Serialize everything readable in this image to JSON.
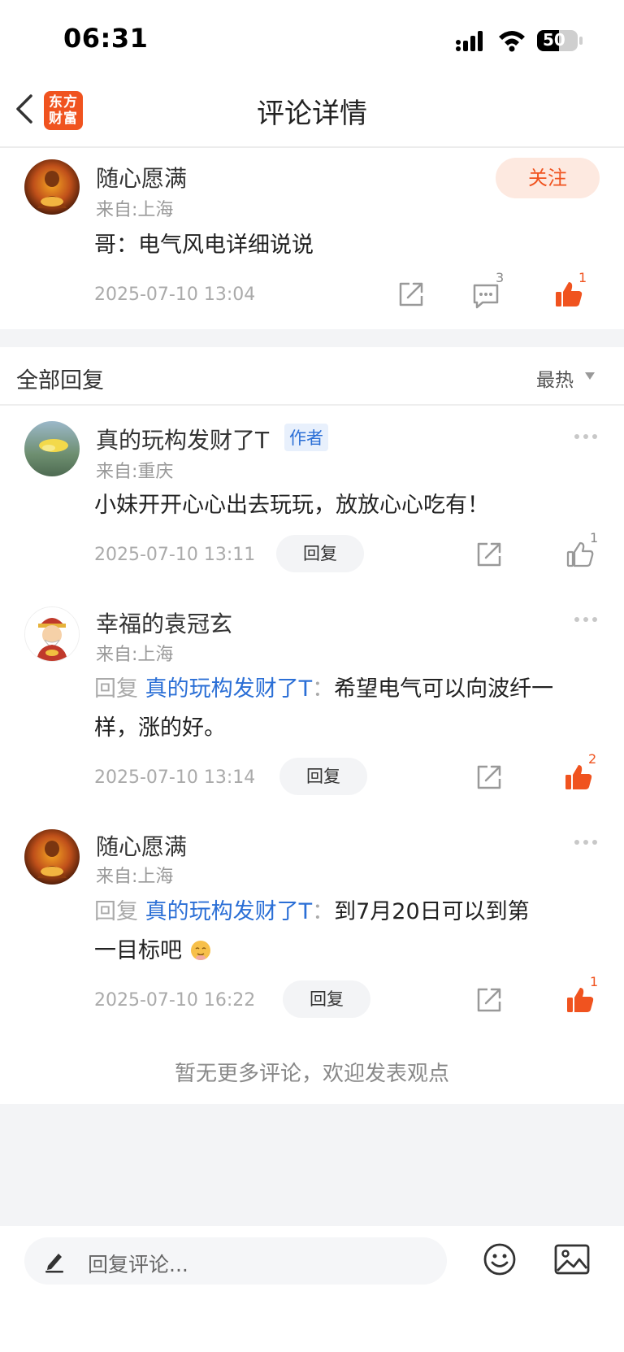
{
  "status_bar": {
    "time": "06:31",
    "battery": "50"
  },
  "nav": {
    "logo_line1": "东方",
    "logo_line2": "财富",
    "title": "评论详情"
  },
  "main_comment": {
    "author": "随心愿满",
    "from": "来自:上海",
    "follow_label": "关注",
    "content": "哥：电气风电详细说说",
    "timestamp": "2025-07-10 13:04",
    "reply_count": "3",
    "like_count": "1"
  },
  "replies_section": {
    "title": "全部回复",
    "sort_label": "最热"
  },
  "replies": [
    {
      "author": "真的玩构发财了T",
      "tag": "作者",
      "from": "来自:重庆",
      "content": "小妹开开心心出去玩玩，放放心心吃有！",
      "timestamp": "2025-07-10 13:11",
      "reply_label": "回复",
      "like_count": "1"
    },
    {
      "author": "幸福的袁冠玄",
      "from": "来自:上海",
      "reply_prefix": "回复",
      "reply_to": "真的玩构发财了T",
      "reply_colon": "：",
      "content_line1": "希望电气可以向波纤一",
      "content_line2": "样，涨的好。",
      "timestamp": "2025-07-10 13:14",
      "reply_label": "回复",
      "like_count": "2"
    },
    {
      "author": "随心愿满",
      "from": "来自:上海",
      "reply_prefix": "回复",
      "reply_to": "真的玩构发财了T",
      "reply_colon": "：",
      "content_line1": "到7月20日可以到第",
      "content_line2": "一目标吧",
      "timestamp": "2025-07-10 16:22",
      "reply_label": "回复",
      "like_count": "1"
    }
  ],
  "footer": {
    "no_more_text": "暂无更多评论，欢迎发表观点"
  },
  "reply_input": {
    "placeholder": "回复评论..."
  },
  "colors": {
    "accent": "#f0531f",
    "link": "#2b6fd6"
  }
}
